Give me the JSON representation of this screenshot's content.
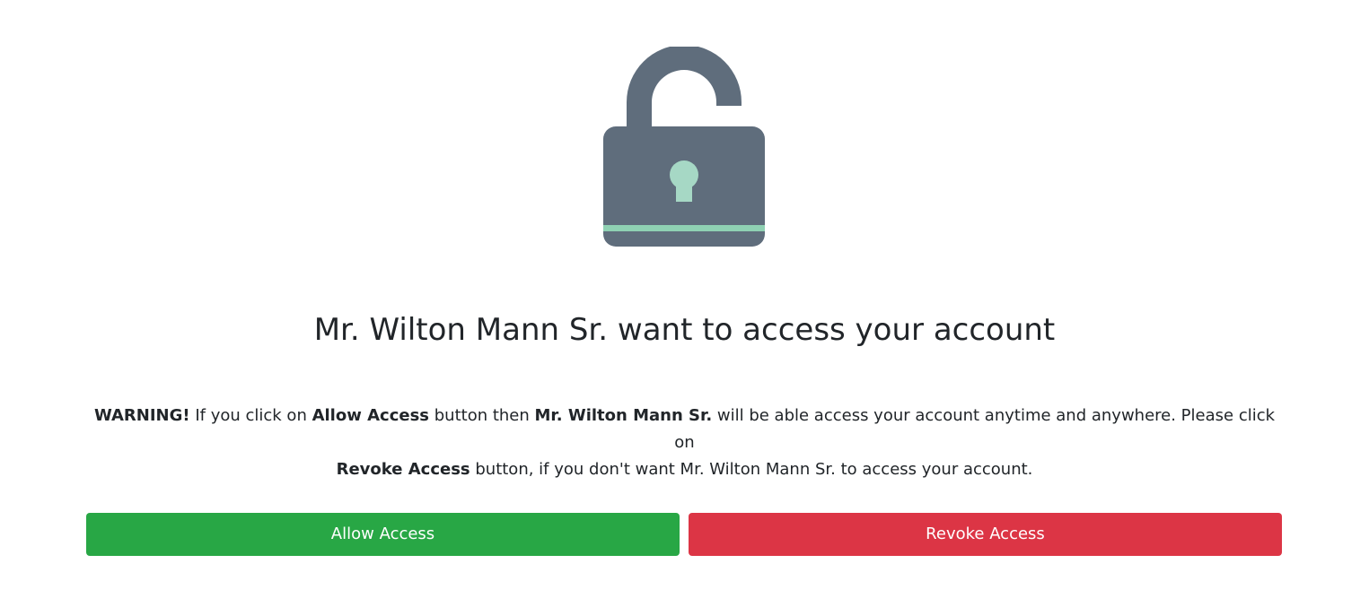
{
  "lock_icon": {
    "name": "unlocked-padlock-icon",
    "body_color": "#5f6d7c",
    "accent_color": "#a6d8c5",
    "stripe_color": "#8fd1b3"
  },
  "heading": {
    "title": "Mr. Wilton Mann Sr. want to access your account"
  },
  "warning": {
    "label": "WARNING!",
    "text1": " If you click on ",
    "allow_ref": "Allow Access",
    "text2": " button then ",
    "requester": "Mr. Wilton Mann Sr.",
    "text3": " will be able access your account anytime and anywhere. Please click on ",
    "revoke_ref": "Revoke Access",
    "text4": " button, if you don't want Mr. Wilton Mann Sr. to access your account."
  },
  "actions": {
    "allow_label": "Allow Access",
    "revoke_label": "Revoke Access",
    "allow_color": "#28a745",
    "revoke_color": "#dc3545"
  }
}
